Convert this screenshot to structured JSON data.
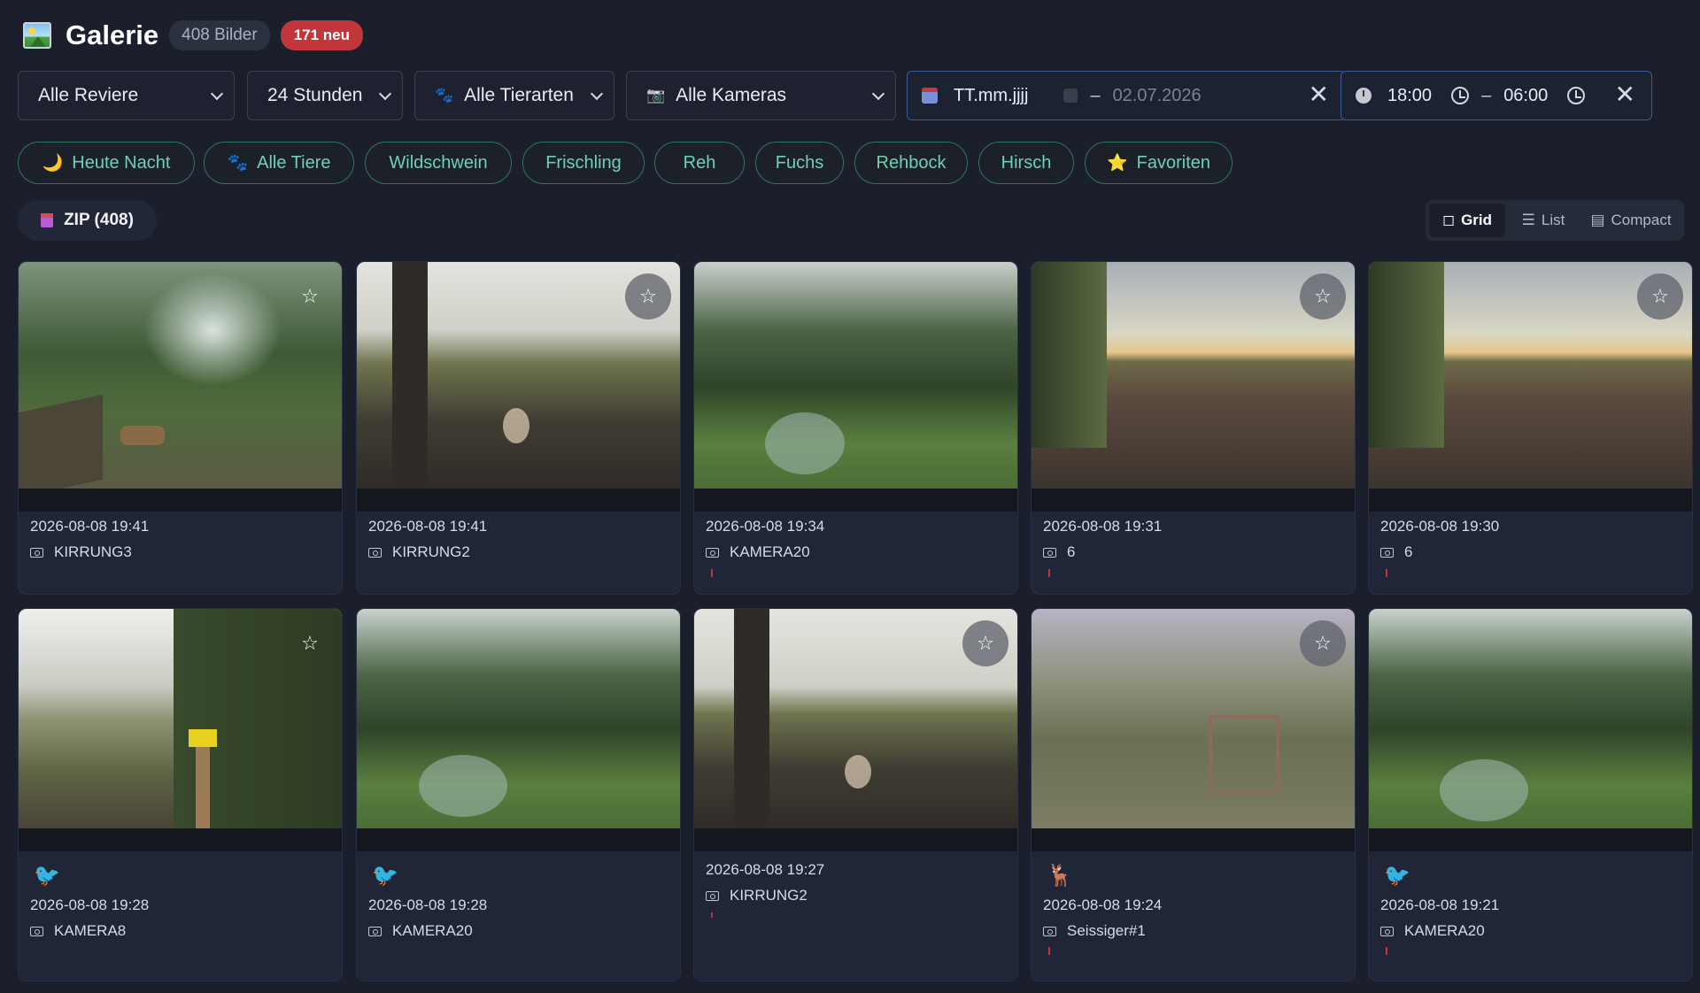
{
  "header": {
    "title": "Galerie",
    "count": "408 Bilder",
    "new_badge": "171 neu"
  },
  "filters": {
    "revier": "Alle Reviere",
    "timespan": "24 Stunden",
    "species": "Alle Tierarten",
    "camera": "Alle Kameras",
    "date_from": "TT.mm.jjjj",
    "date_to": "02.07.2026",
    "time_from": "18:00",
    "time_to": "06:00",
    "range_dash": "–"
  },
  "chips": [
    {
      "label": "Heute Nacht",
      "icon": "moon-icon",
      "glyph": "🌙"
    },
    {
      "label": "Alle Tiere",
      "icon": "paw-icon",
      "glyph": "🐾"
    },
    {
      "label": "Wildschwein",
      "icon": "",
      "glyph": ""
    },
    {
      "label": "Frischling",
      "icon": "",
      "glyph": ""
    },
    {
      "label": "Reh",
      "icon": "",
      "glyph": ""
    },
    {
      "label": "Fuchs",
      "icon": "",
      "glyph": ""
    },
    {
      "label": "Rehbock",
      "icon": "",
      "glyph": ""
    },
    {
      "label": "Hirsch",
      "icon": "",
      "glyph": ""
    },
    {
      "label": "Favoriten",
      "icon": "star-icon",
      "glyph": "⭐"
    }
  ],
  "zip_button": "ZIP (408)",
  "view": {
    "grid": "Grid",
    "list": "List",
    "compact": "Compact",
    "active": "grid"
  },
  "cards": [
    {
      "timestamp": "2026-08-08 19:41",
      "camera": "KIRRUNG3",
      "animal": ""
    },
    {
      "timestamp": "2026-08-08 19:41",
      "camera": "KIRRUNG2",
      "animal": ""
    },
    {
      "timestamp": "2026-08-08 19:34",
      "camera": "KAMERA20",
      "animal": ""
    },
    {
      "timestamp": "2026-08-08 19:31",
      "camera": "6",
      "animal": ""
    },
    {
      "timestamp": "2026-08-08 19:30",
      "camera": "6",
      "animal": ""
    },
    {
      "timestamp": "2026-08-08 19:28",
      "camera": "KAMERA8",
      "animal": "bird-icon",
      "animal_glyph": "🐦"
    },
    {
      "timestamp": "2026-08-08 19:28",
      "camera": "KAMERA20",
      "animal": "bird-icon",
      "animal_glyph": "🐦"
    },
    {
      "timestamp": "2026-08-08 19:27",
      "camera": "KIRRUNG2",
      "animal": ""
    },
    {
      "timestamp": "2026-08-08 19:24",
      "camera": "Seissiger#1",
      "animal": "deer-icon",
      "animal_glyph": "🦌"
    },
    {
      "timestamp": "2026-08-08 19:21",
      "camera": "KAMERA20",
      "animal": "bird-icon",
      "animal_glyph": "🐦"
    }
  ],
  "colors": {
    "background": "#1b1f2b",
    "chip_accent": "#6ed2b0",
    "new_badge": "#c0363b",
    "range_border": "#3a5c96"
  }
}
